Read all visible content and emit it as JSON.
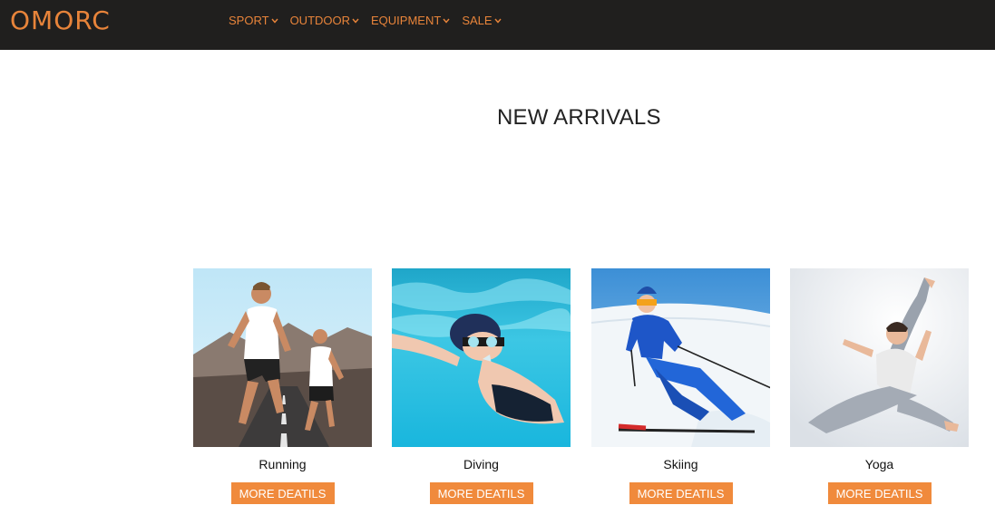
{
  "header": {
    "logo": "OMORC",
    "nav": [
      {
        "label": "SPORT"
      },
      {
        "label": "OUTDOOR"
      },
      {
        "label": "EQUIPMENT"
      },
      {
        "label": "SALE"
      }
    ]
  },
  "main": {
    "title": "NEW ARRIVALS",
    "cards": [
      {
        "caption": "Running",
        "button": "MORE DEATILS"
      },
      {
        "caption": "Diving",
        "button": "MORE DEATILS"
      },
      {
        "caption": "Skiing",
        "button": "MORE DEATILS"
      },
      {
        "caption": "Yoga",
        "button": "MORE DEATILS"
      }
    ]
  },
  "colors": {
    "header_bg": "#201f1e",
    "accent": "#e8843a",
    "button_bg": "#f08a3c"
  },
  "icons": [
    "chevron-down-icon"
  ]
}
